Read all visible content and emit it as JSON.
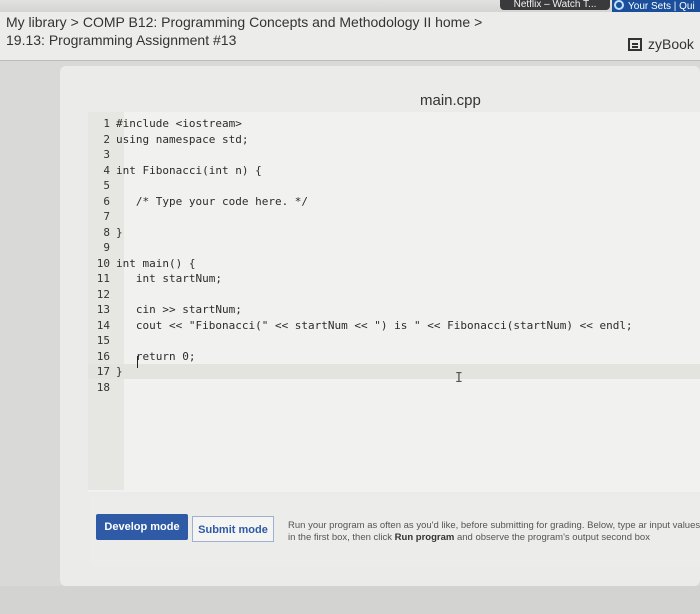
{
  "browser": {
    "tab_dark": "Netflix – Watch T...",
    "tab_blue": "Your Sets | Qui"
  },
  "header": {
    "breadcrumb": [
      "My library",
      "COMP B12: Programming Concepts and Methodology II home",
      ""
    ],
    "assignment": "19.13: Programming Assignment #13",
    "zybook": "zyBook"
  },
  "editor": {
    "filename": "main.cpp",
    "lines": [
      {
        "n": "1",
        "code": "#include <iostream>"
      },
      {
        "n": "2",
        "code": "using namespace std;"
      },
      {
        "n": "3",
        "code": ""
      },
      {
        "n": "4",
        "code": "int Fibonacci(int n) {"
      },
      {
        "n": "5",
        "code": ""
      },
      {
        "n": "6",
        "code": "   /* Type your code here. */"
      },
      {
        "n": "7",
        "code": ""
      },
      {
        "n": "8",
        "code": "}"
      },
      {
        "n": "9",
        "code": ""
      },
      {
        "n": "10",
        "code": "int main() {"
      },
      {
        "n": "11",
        "code": "   int startNum;"
      },
      {
        "n": "12",
        "code": ""
      },
      {
        "n": "13",
        "code": "   cin >> startNum;"
      },
      {
        "n": "14",
        "code": "   cout << \"Fibonacci(\" << startNum << \") is \" << Fibonacci(startNum) << endl;"
      },
      {
        "n": "15",
        "code": ""
      },
      {
        "n": "16",
        "code": "   return 0;"
      },
      {
        "n": "17",
        "code": "}"
      },
      {
        "n": "18",
        "code": ""
      }
    ]
  },
  "actions": {
    "develop_label": "Develop mode",
    "submit_label": "Submit mode",
    "help_part1": "Run your program as often as you'd like, before submitting for grading. Below, type ar input values in the first box, then click ",
    "help_bold": "Run program",
    "help_part2": " and observe the program's output second box"
  },
  "colors": {
    "accent": "#2e5aa6",
    "background": "#d9d9d7"
  }
}
